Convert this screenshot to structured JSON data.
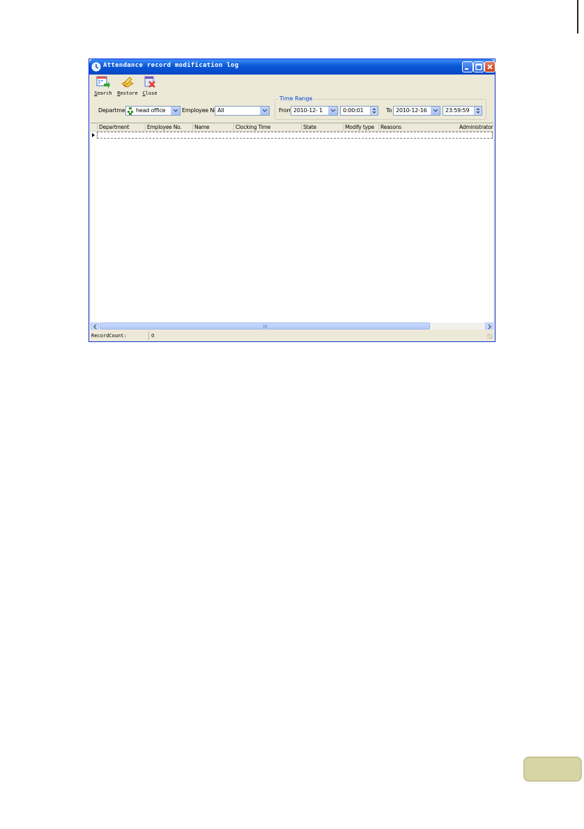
{
  "window": {
    "title": "Attendance record modification log"
  },
  "toolbar": {
    "search_label": "Search",
    "restore_label": "Restore",
    "close_label": "Close"
  },
  "filters": {
    "department_label": "Department",
    "department_value": "head office",
    "employee_label": "Employee No.",
    "employee_value": "All",
    "time_range_legend": "Time Range",
    "from_label": "From",
    "from_date": "2010-12- 1",
    "from_time": "0:00:01",
    "to_label": "To",
    "to_date": "2010-12-16",
    "to_time": "23:59:59"
  },
  "grid": {
    "columns": [
      "Department",
      "Employee No.",
      "Name",
      "Clocking Time",
      "State",
      "Modify type",
      "Reasons",
      "Administrator"
    ],
    "rows": []
  },
  "status": {
    "record_count_label": "RecordCount:",
    "record_count_value": "0"
  },
  "colors": {
    "titlebar": "#0a58d8",
    "window_face": "#ece9d8",
    "page_badge": "#d7d4a6"
  }
}
